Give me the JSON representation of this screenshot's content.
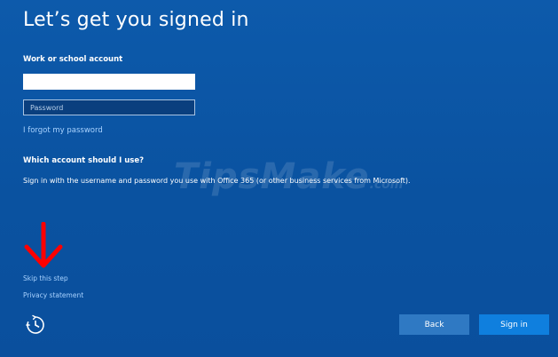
{
  "page": {
    "title": "Let’s get you signed in"
  },
  "form": {
    "section_label": "Work or school account",
    "email_value": "",
    "password_placeholder": "Password",
    "forgot_link": "I forgot my password"
  },
  "help": {
    "heading": "Which account should I use?",
    "body": "Sign in with the username and password you use with Office 365 (or other business services from Microsoft)."
  },
  "watermark": {
    "text": "TipsMake",
    "suffix": ".com"
  },
  "footer": {
    "skip_link": "Skip this step",
    "privacy_link": "Privacy statement",
    "back_label": "Back",
    "signin_label": "Sign in"
  },
  "icons": {
    "ease_of_access": "ease-of-access-icon",
    "annotation_arrow": "red-down-arrow"
  },
  "colors": {
    "background": "#0b56a8",
    "link": "#a8d2ff",
    "primary_button": "#0f7fde",
    "secondary_button": "#2f79c3",
    "annotation": "#ff0000"
  }
}
